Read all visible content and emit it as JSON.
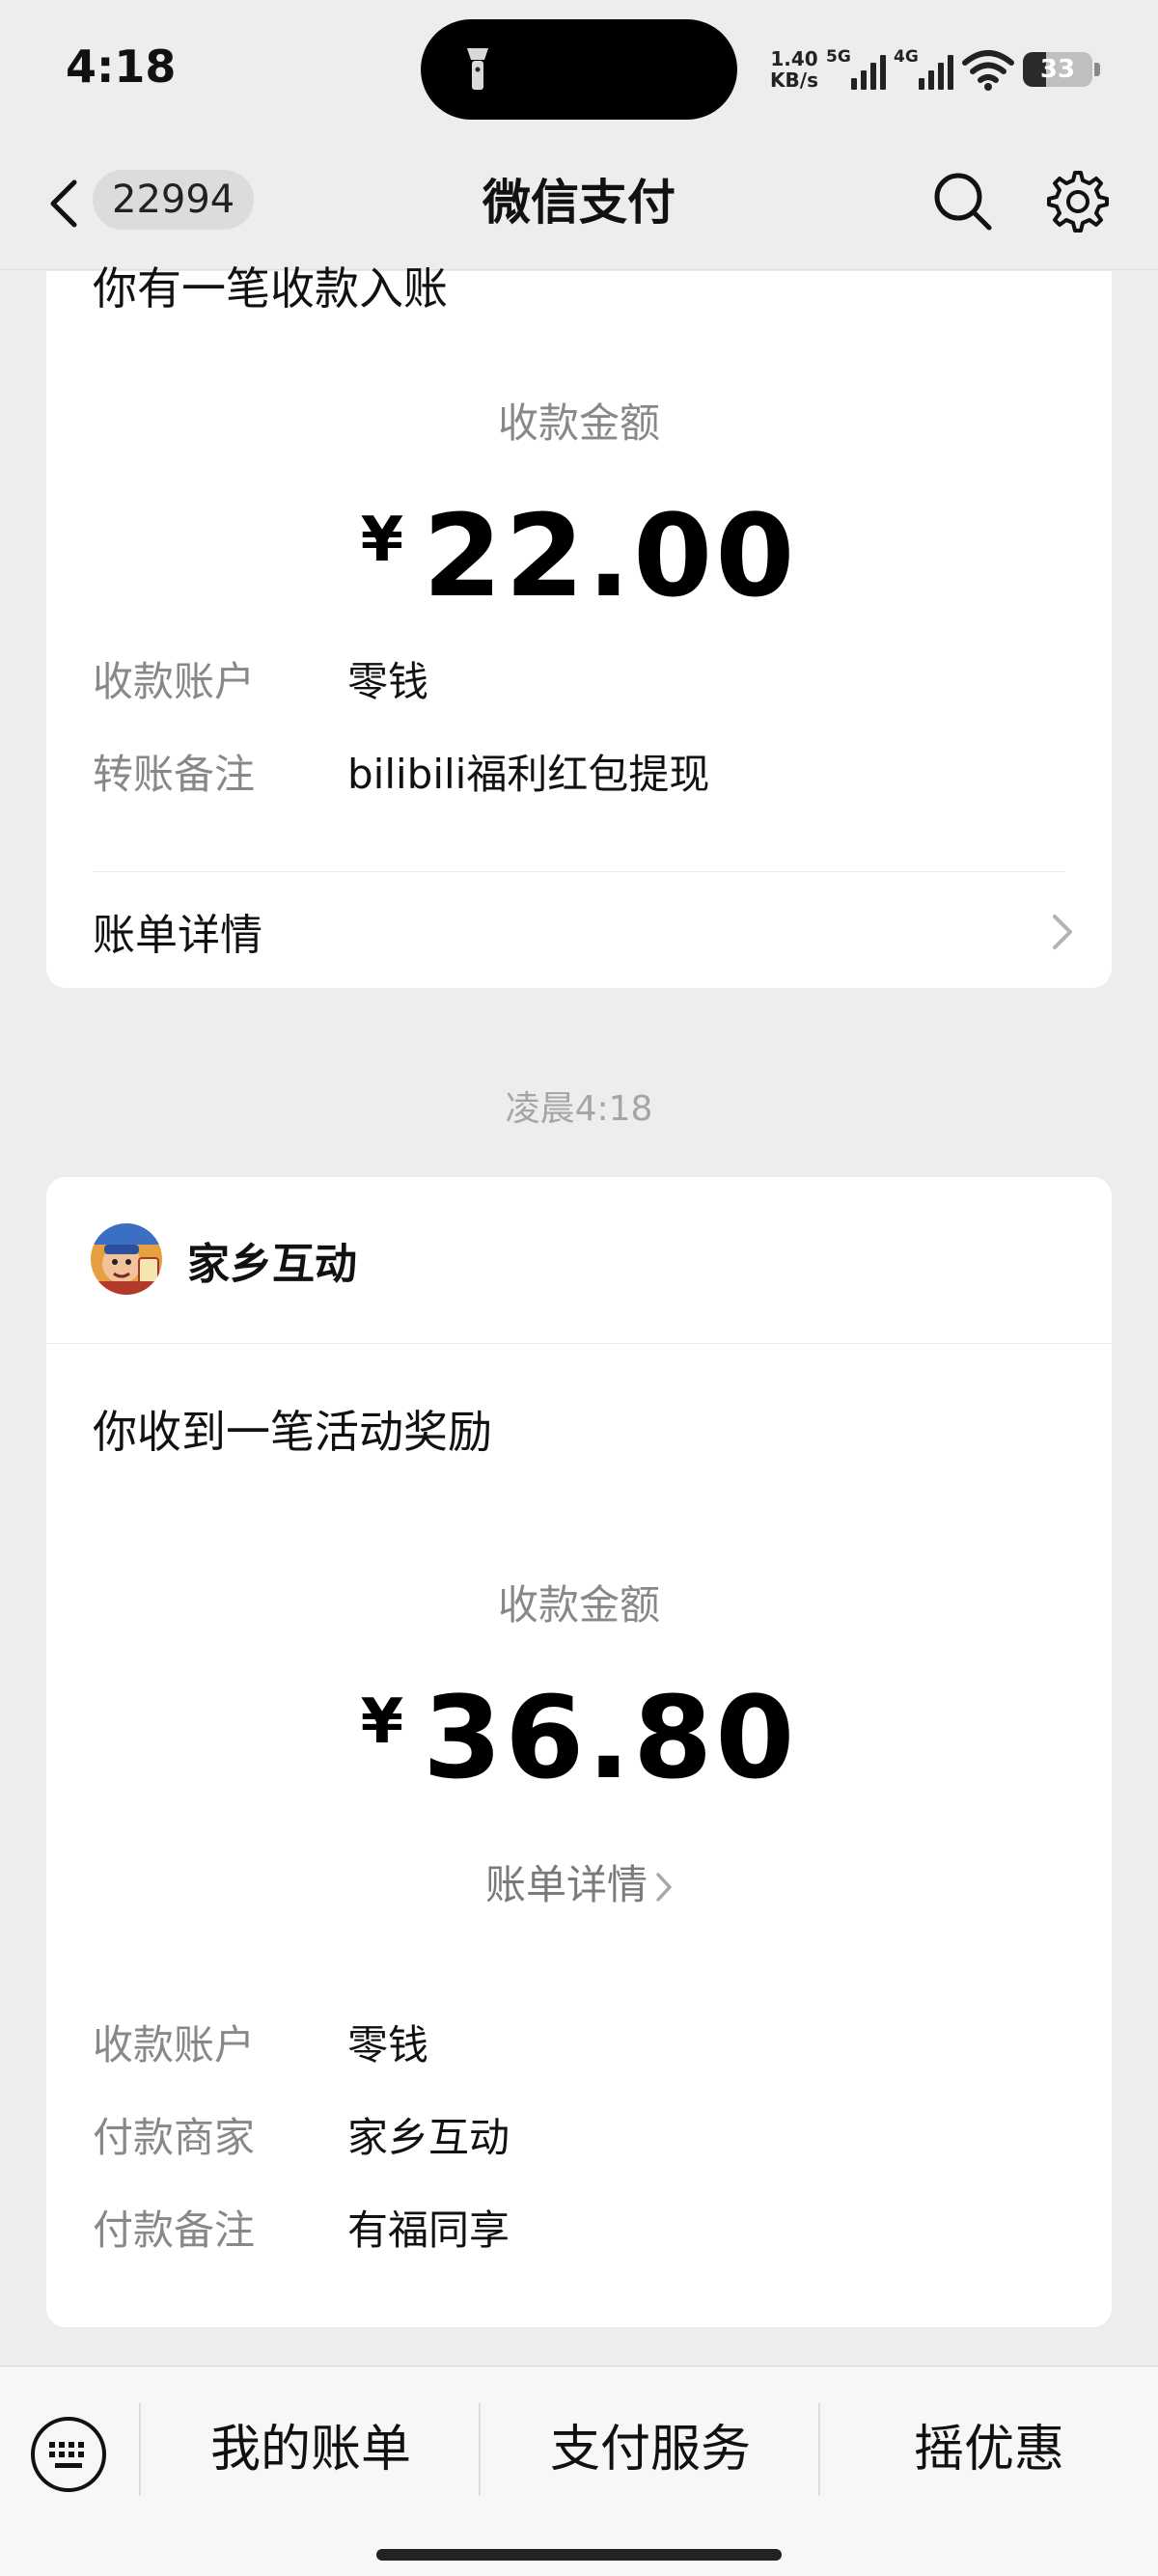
{
  "status_bar": {
    "time": "4:18",
    "net_speed_value": "1.40",
    "net_speed_unit": "KB/s",
    "sim1_label": "5G",
    "sim2_label": "4G",
    "battery": "33",
    "battery_level": 0.33
  },
  "nav": {
    "unread_count": "22994",
    "title": "微信支付"
  },
  "message1": {
    "headline": "你有一笔收款入账",
    "amount_label": "收款金额",
    "currency": "¥",
    "amount": "22.00",
    "rows": [
      {
        "key": "收款账户",
        "value": "零钱"
      },
      {
        "key": "转账备注",
        "value": "bilibili福利红包提现"
      }
    ],
    "bill_details": "账单详情"
  },
  "time_divider": "凌晨4:18",
  "message2": {
    "merchant": "家乡互动",
    "headline": "你收到一笔活动奖励",
    "amount_label": "收款金额",
    "currency": "¥",
    "amount": "36.80",
    "bill_details": "账单详情",
    "rows": [
      {
        "key": "收款账户",
        "value": "零钱"
      },
      {
        "key": "付款商家",
        "value": "家乡互动"
      },
      {
        "key": "付款备注",
        "value": "有福同享"
      }
    ]
  },
  "bottom_menu": [
    "我的账单",
    "支付服务",
    "摇优惠"
  ],
  "colors": {
    "background": "#ededed",
    "card": "#ffffff",
    "label_gray": "#888888"
  }
}
